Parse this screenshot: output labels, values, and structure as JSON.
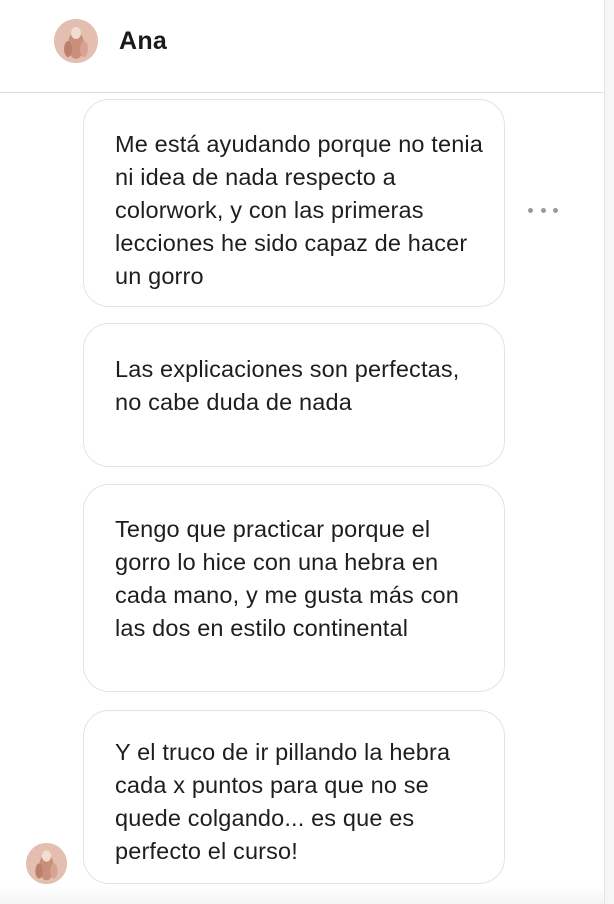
{
  "conversation": {
    "contact_name": "Ana"
  },
  "messages": [
    {
      "text": "Me está ayudando porque no tenia ni idea de nada respecto a colorwork, y con las primeras lecciones he sido capaz de hacer un gorro"
    },
    {
      "text": "Las explicaciones son perfectas, no cabe duda de nada"
    },
    {
      "text": "Tengo que practicar porque el gorro lo hice con una hebra en cada mano, y me gusta más con las dos en estilo continental"
    },
    {
      "text": "Y el truco de ir pillando la hebra cada x puntos para que no se quede colgando... es que es perfecto el curso!"
    }
  ],
  "icons": {
    "more": "more-options-icon",
    "avatar": "contact-avatar"
  },
  "colors": {
    "bubble_border": "#e3e3e3",
    "text": "#1e1e1e",
    "divider": "#dcdcdc"
  }
}
